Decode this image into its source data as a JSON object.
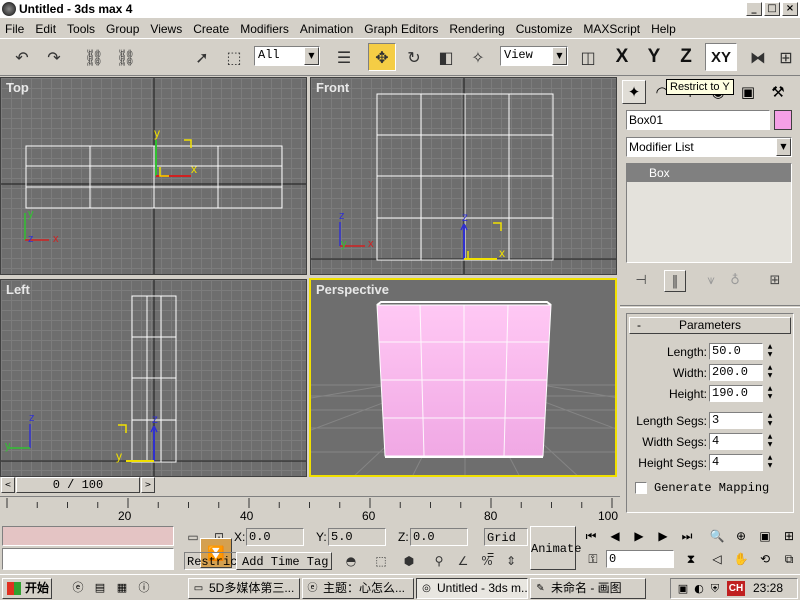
{
  "window": {
    "title": "Untitled - 3ds max 4",
    "min": "_",
    "max": "□",
    "close": "×"
  },
  "menu": [
    "File",
    "Edit",
    "Tools",
    "Group",
    "Views",
    "Create",
    "Modifiers",
    "Animation",
    "Graph Editors",
    "Rendering",
    "Customize",
    "MAXScript",
    "Help"
  ],
  "toolbar": {
    "selection_filter": "All",
    "ref_coord": "View",
    "axis_x": "X",
    "axis_y": "Y",
    "axis_z": "Z",
    "axis_xy": "XY",
    "tooltip": "Restrict to Y",
    "icons": [
      "undo-icon",
      "redo-icon",
      "link-icon",
      "unlink-icon",
      "select-arrow-icon",
      "region-select-icon",
      "select-by-name-icon",
      "move-icon",
      "rotate-icon",
      "scale-icon",
      "manipulate-icon",
      "pivot-icon",
      "mirror-icon",
      "align-icon"
    ]
  },
  "viewports": {
    "top": {
      "label": "Top"
    },
    "front": {
      "label": "Front"
    },
    "left": {
      "label": "Left"
    },
    "perspective": {
      "label": "Perspective"
    }
  },
  "axes": {
    "x": "x",
    "y": "y",
    "z": "z"
  },
  "command_panel": {
    "tabs": [
      "create-icon",
      "modify-icon",
      "hierarchy-icon",
      "motion-icon",
      "display-icon",
      "utilities-icon"
    ],
    "object_name": "Box01",
    "object_color": "#f5a0e6",
    "modifier_list_label": "Modifier List",
    "stack": [
      "Box"
    ],
    "rollout_title": "Parameters",
    "rollout_toggle": "-",
    "params": [
      {
        "label": "Length:",
        "value": "50.0"
      },
      {
        "label": "Width:",
        "value": "200.0"
      },
      {
        "label": "Height:",
        "value": "190.0"
      },
      {
        "label": "Length Segs:",
        "value": "3"
      },
      {
        "label": "Width Segs:",
        "value": "4"
      },
      {
        "label": "Height Segs:",
        "value": "4"
      }
    ],
    "generate_mapping": "Generate Mapping",
    "generate_mapping_checked": false
  },
  "time_slider": {
    "label": "0 / 100",
    "prev": "<",
    "next": ">"
  },
  "track": {
    "ticks": [
      "0",
      "20",
      "40",
      "60",
      "80",
      "100"
    ],
    "labels": [
      "20",
      "40",
      "60",
      "80",
      "100"
    ]
  },
  "status": {
    "x_label": "X:",
    "x_value": "0.0",
    "y_label": "Y:",
    "y_value": "5.0",
    "z_label": "Z:",
    "z_value": "0.0",
    "grid": "Grid =",
    "prompt": "Restric",
    "add_time_tag": "Add Time Tag",
    "animate": "Animate",
    "frame": "0"
  },
  "taskbar": {
    "start": "开始",
    "tasks": [
      {
        "label": "5D多媒体第三...",
        "active": false
      },
      {
        "label": "主题：心怎么...",
        "active": false
      },
      {
        "label": "Untitled - 3ds m...",
        "active": true
      },
      {
        "label": "未命名 - 画图",
        "active": false
      }
    ],
    "ime": "CH",
    "clock": "23:28"
  }
}
